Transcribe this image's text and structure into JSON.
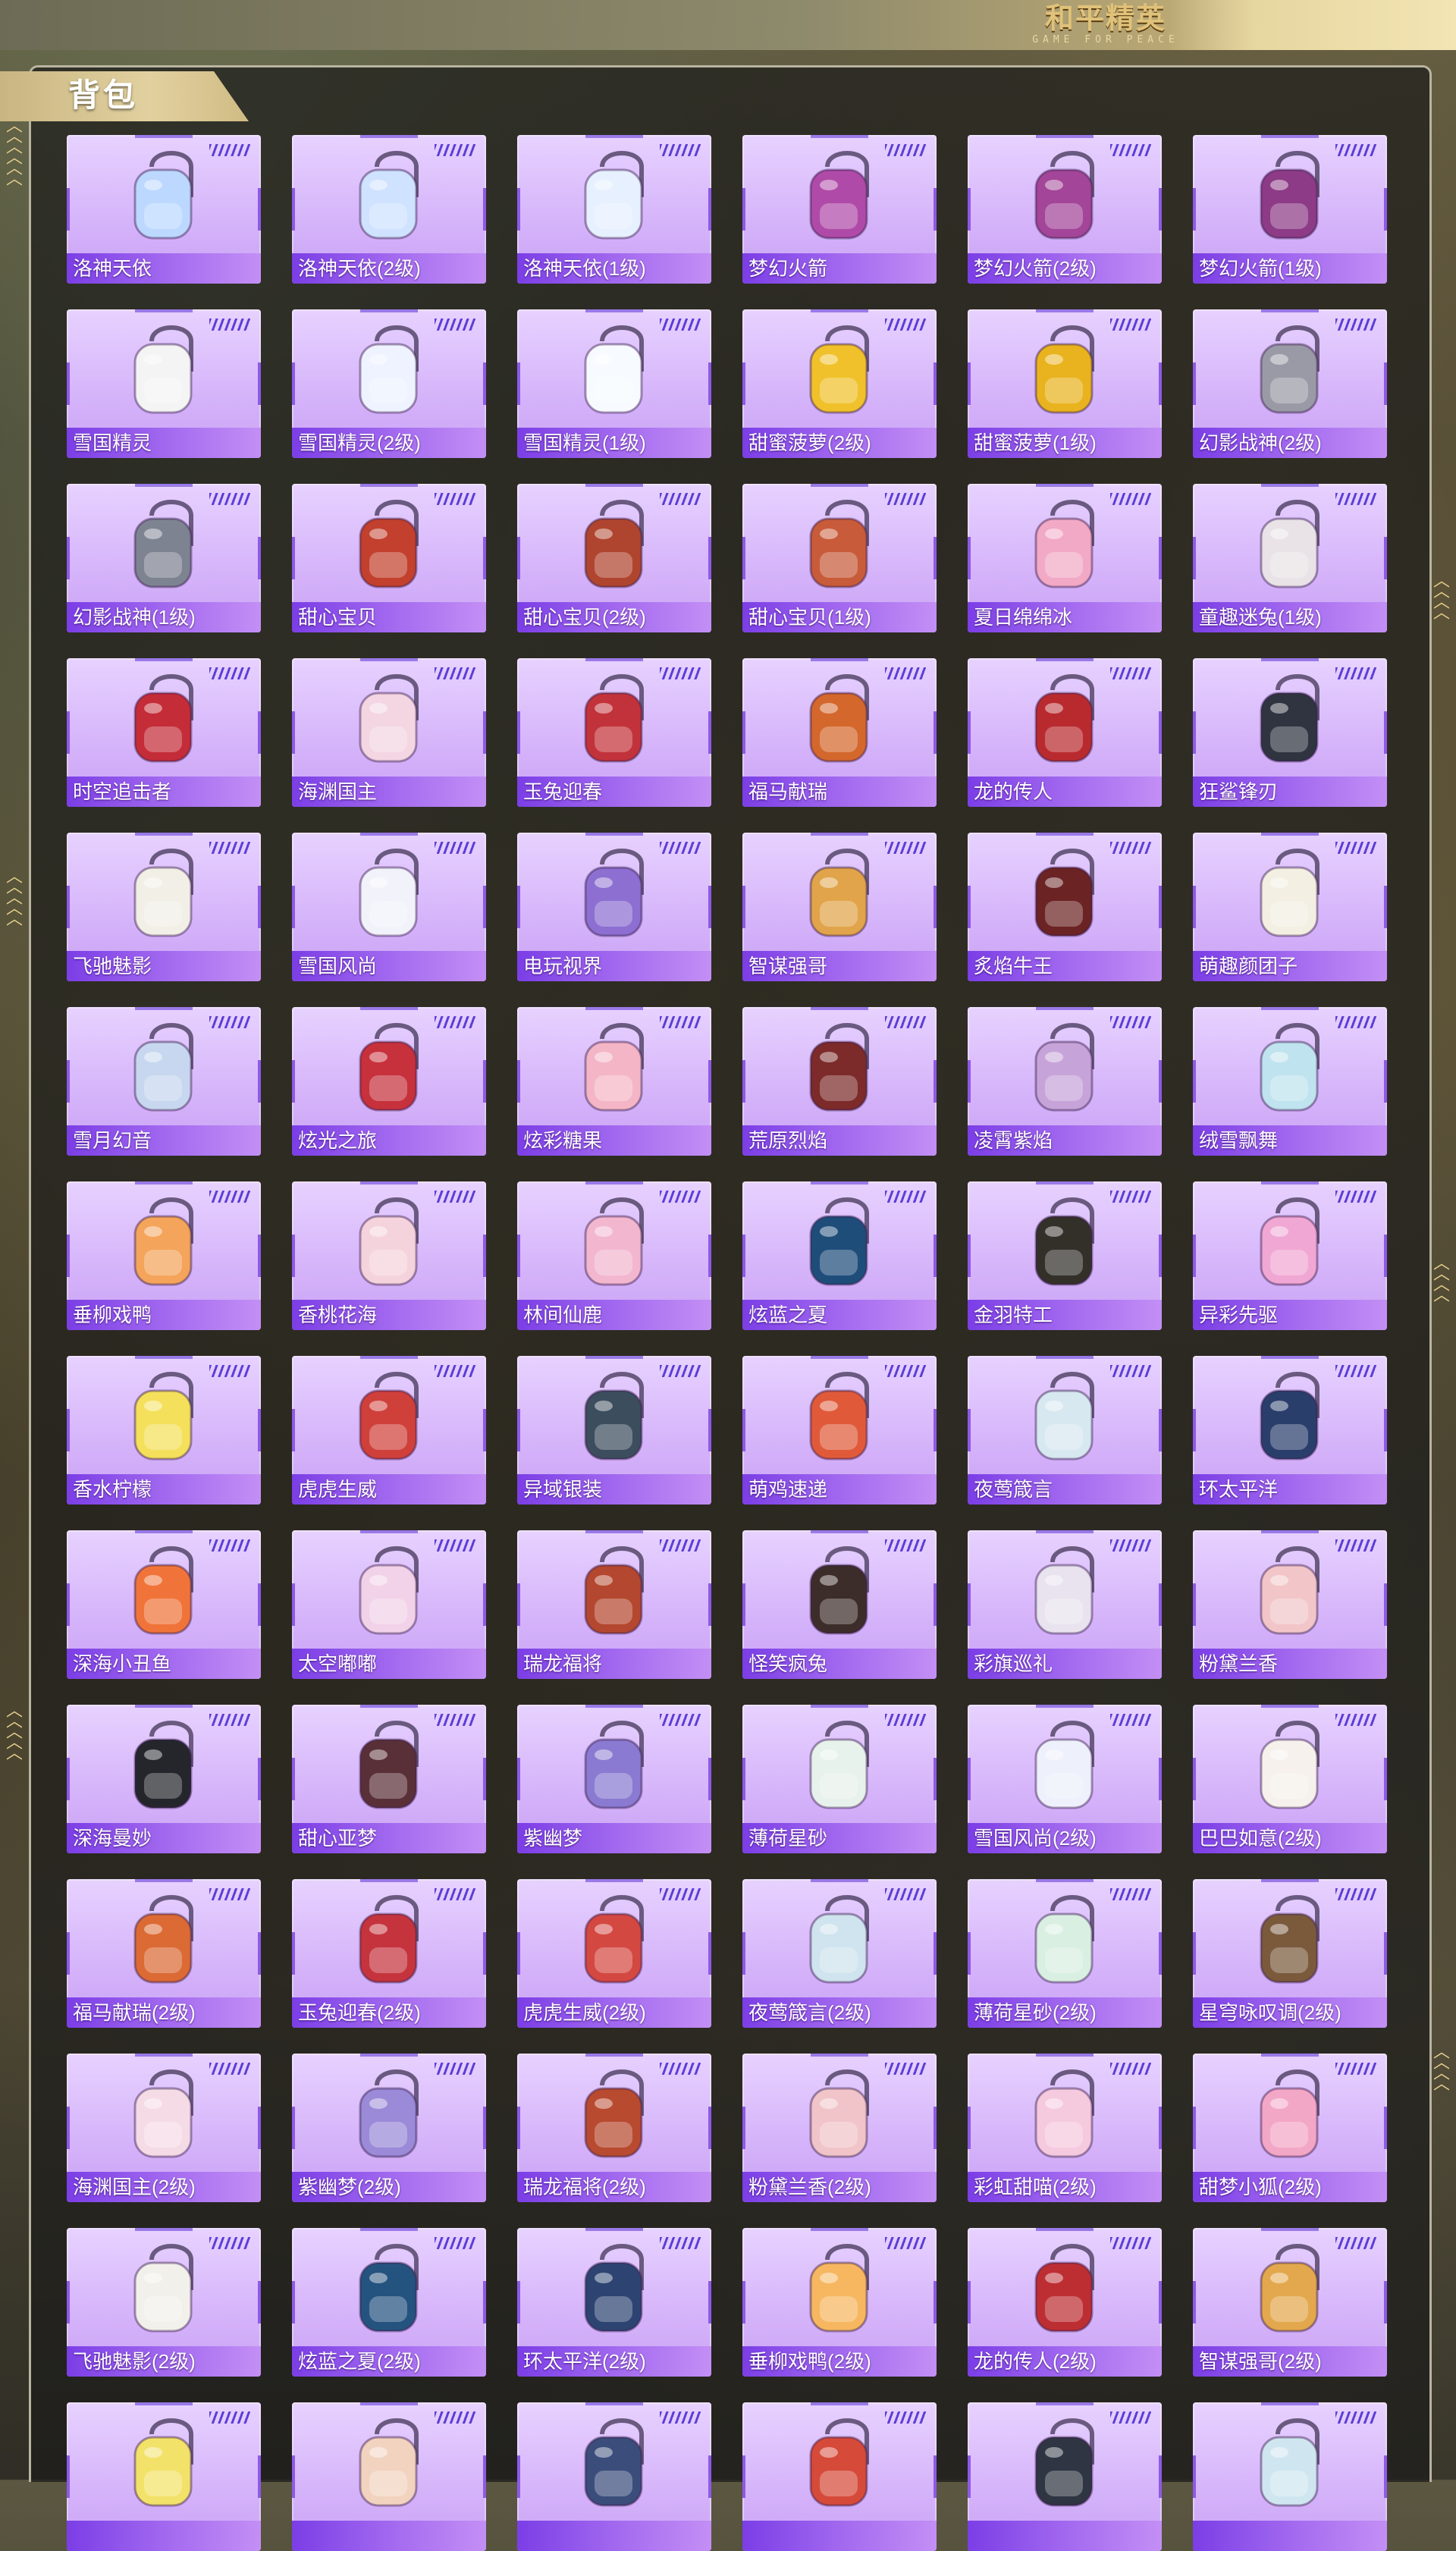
{
  "brand": {
    "logo_main": "和平精英",
    "logo_sub": "GAME FOR PEACE"
  },
  "section": {
    "title": "背包"
  },
  "items": [
    {
      "name": "洛神天依",
      "color": "#bcd8ff"
    },
    {
      "name": "洛神天依(2级)",
      "color": "#cfe2ff"
    },
    {
      "name": "洛神天依(1级)",
      "color": "#e6f0ff"
    },
    {
      "name": "梦幻火箭",
      "color": "#b04aa8"
    },
    {
      "name": "梦幻火箭(2级)",
      "color": "#a34598"
    },
    {
      "name": "梦幻火箭(1级)",
      "color": "#8d3b86"
    },
    {
      "name": "雪国精灵",
      "color": "#f4f4f4"
    },
    {
      "name": "雪国精灵(2级)",
      "color": "#eef3ff"
    },
    {
      "name": "雪国精灵(1级)",
      "color": "#f7fbff"
    },
    {
      "name": "甜蜜菠萝(2级)",
      "color": "#f0c12a"
    },
    {
      "name": "甜蜜菠萝(1级)",
      "color": "#e9b31f"
    },
    {
      "name": "幻影战神(2级)",
      "color": "#9a9aa6"
    },
    {
      "name": "幻影战神(1级)",
      "color": "#7e8392"
    },
    {
      "name": "甜心宝贝",
      "color": "#c2402d"
    },
    {
      "name": "甜心宝贝(2级)",
      "color": "#b0452f"
    },
    {
      "name": "甜心宝贝(1级)",
      "color": "#c85b3a"
    },
    {
      "name": "夏日绵绵冰",
      "color": "#f2a9c5"
    },
    {
      "name": "童趣迷兔(1级)",
      "color": "#e9e3e7"
    },
    {
      "name": "时空追击者",
      "color": "#c42c38"
    },
    {
      "name": "海渊国主",
      "color": "#f3d6e2"
    },
    {
      "name": "玉兔迎春",
      "color": "#c2323a"
    },
    {
      "name": "福马献瑞",
      "color": "#d4672c"
    },
    {
      "name": "龙的传人",
      "color": "#b92a2f"
    },
    {
      "name": "狂鲨锋刃",
      "color": "#2f3440"
    },
    {
      "name": "飞驰魅影",
      "color": "#f1efe6"
    },
    {
      "name": "雪国风尚",
      "color": "#f2f2fb"
    },
    {
      "name": "电玩视界",
      "color": "#8c6fd1"
    },
    {
      "name": "智谋强哥",
      "color": "#e1a44a"
    },
    {
      "name": "炙焰牛王",
      "color": "#6b2323"
    },
    {
      "name": "萌趣颜团子",
      "color": "#f3efe2"
    },
    {
      "name": "雪月幻音",
      "color": "#c7d7ef"
    },
    {
      "name": "炫光之旅",
      "color": "#c7313c"
    },
    {
      "name": "炫彩糖果",
      "color": "#f4b6c6"
    },
    {
      "name": "荒原烈焰",
      "color": "#7c2a2a"
    },
    {
      "name": "凌霄紫焰",
      "color": "#c6a4d9"
    },
    {
      "name": "绒雪飘舞",
      "color": "#bfe3ef"
    },
    {
      "name": "垂柳戏鸭",
      "color": "#f4a45b"
    },
    {
      "name": "香桃花海",
      "color": "#f5d3dc"
    },
    {
      "name": "林间仙鹿",
      "color": "#f2b7cf"
    },
    {
      "name": "炫蓝之夏",
      "color": "#1f4d7a"
    },
    {
      "name": "金羽特工",
      "color": "#33302a"
    },
    {
      "name": "异彩先驱",
      "color": "#f1a7d3"
    },
    {
      "name": "香水柠檬",
      "color": "#f4e05a"
    },
    {
      "name": "虎虎生威",
      "color": "#d0403b"
    },
    {
      "name": "异域银装",
      "color": "#3c4d5e"
    },
    {
      "name": "萌鸡速递",
      "color": "#e05a3a"
    },
    {
      "name": "夜莺箴言",
      "color": "#d7e8f0"
    },
    {
      "name": "环太平洋",
      "color": "#2a3e6c"
    },
    {
      "name": "深海小丑鱼",
      "color": "#f0743a"
    },
    {
      "name": "太空嘟嘟",
      "color": "#f2d2e8"
    },
    {
      "name": "瑞龙福将",
      "color": "#b4472f"
    },
    {
      "name": "怪笑疯兔",
      "color": "#3d2d2a"
    },
    {
      "name": "彩旗巡礼",
      "color": "#e8e3ef"
    },
    {
      "name": "粉黛兰香",
      "color": "#f2c6c9"
    },
    {
      "name": "深海曼妙",
      "color": "#24262c"
    },
    {
      "name": "甜心亚梦",
      "color": "#5a3038"
    },
    {
      "name": "紫幽梦",
      "color": "#8a7ad1"
    },
    {
      "name": "薄荷星砂",
      "color": "#e8f2ec"
    },
    {
      "name": "雪国风尚(2级)",
      "color": "#eef0fb"
    },
    {
      "name": "巴巴如意(2级)",
      "color": "#f6f1ec"
    },
    {
      "name": "福马献瑞(2级)",
      "color": "#dc6a34"
    },
    {
      "name": "玉兔迎春(2级)",
      "color": "#c5343d"
    },
    {
      "name": "虎虎生威(2级)",
      "color": "#d44842"
    },
    {
      "name": "夜莺箴言(2级)",
      "color": "#cfe4ee"
    },
    {
      "name": "薄荷星砂(2级)",
      "color": "#d9efe2"
    },
    {
      "name": "星穹咏叹调(2级)",
      "color": "#7b5a3c"
    },
    {
      "name": "海渊国主(2级)",
      "color": "#f5dbe6"
    },
    {
      "name": "紫幽梦(2级)",
      "color": "#9a8ad8"
    },
    {
      "name": "瑞龙福将(2级)",
      "color": "#b84a30"
    },
    {
      "name": "粉黛兰香(2级)",
      "color": "#f0c4c8"
    },
    {
      "name": "彩虹甜喵(2级)",
      "color": "#f5c9de"
    },
    {
      "name": "甜梦小狐(2级)",
      "color": "#f3a7c6"
    },
    {
      "name": "飞驰魅影(2级)",
      "color": "#f2f0ea"
    },
    {
      "name": "炫蓝之夏(2级)",
      "color": "#25537f"
    },
    {
      "name": "环太平洋(2级)",
      "color": "#2d4472"
    },
    {
      "name": "垂柳戏鸭(2级)",
      "color": "#f6b760"
    },
    {
      "name": "龙的传人(2级)",
      "color": "#bd2e33"
    },
    {
      "name": "智谋强哥(2级)",
      "color": "#e3a84d"
    },
    {
      "name": "",
      "color": "#f3e26a"
    },
    {
      "name": "",
      "color": "#f2d3c0"
    },
    {
      "name": "",
      "color": "#3b4d7a"
    },
    {
      "name": "",
      "color": "#d64a3a"
    },
    {
      "name": "",
      "color": "#2f3542"
    },
    {
      "name": "",
      "color": "#cfe6f0"
    }
  ]
}
